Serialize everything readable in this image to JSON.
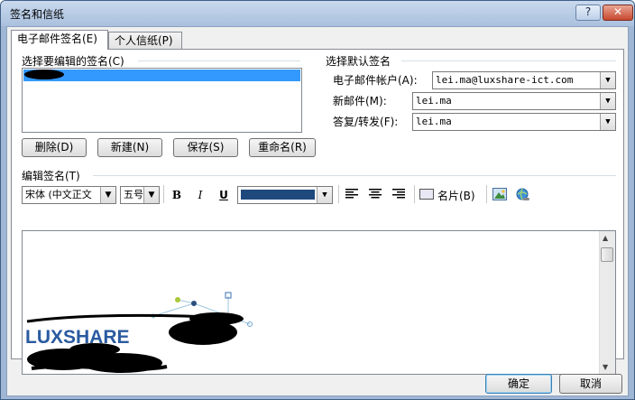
{
  "window": {
    "title": "签名和信纸",
    "help_label": "?",
    "close_label": "✕"
  },
  "tabs": [
    {
      "label": "电子邮件签名(E)",
      "active": true
    },
    {
      "label": "个人信纸(P)",
      "active": false
    }
  ],
  "signature_list": {
    "label": "选择要编辑的签名(C)"
  },
  "buttons": {
    "delete": "删除(D)",
    "new": "新建(N)",
    "save": "保存(S)",
    "rename": "重命名(R)"
  },
  "defaults": {
    "section_label": "选择默认签名",
    "account_label": "电子邮件帐户(A):",
    "account_value": "lei.ma@luxshare-ict.com",
    "new_label": "新邮件(M):",
    "new_value": "lei.ma",
    "reply_label": "答复/转发(F):",
    "reply_value": "lei.ma"
  },
  "editor": {
    "section_label": "编辑签名(T)",
    "font_value": "宋体 (中文正文",
    "size_value": "五号",
    "bold": "B",
    "italic": "I",
    "underline": "U",
    "text_color": "#1f497d",
    "business_card_label": "名片(B)",
    "logo_text": "LUXSHARE"
  },
  "footer": {
    "ok_label": "确定",
    "cancel_label": "取消"
  },
  "icons": [
    "help-icon",
    "close-icon",
    "dropdown-arrow-icon",
    "align-left-icon",
    "align-center-icon",
    "align-right-icon",
    "business-card-icon",
    "insert-picture-icon",
    "hyperlink-icon",
    "scroll-up-icon",
    "scroll-down-icon"
  ]
}
